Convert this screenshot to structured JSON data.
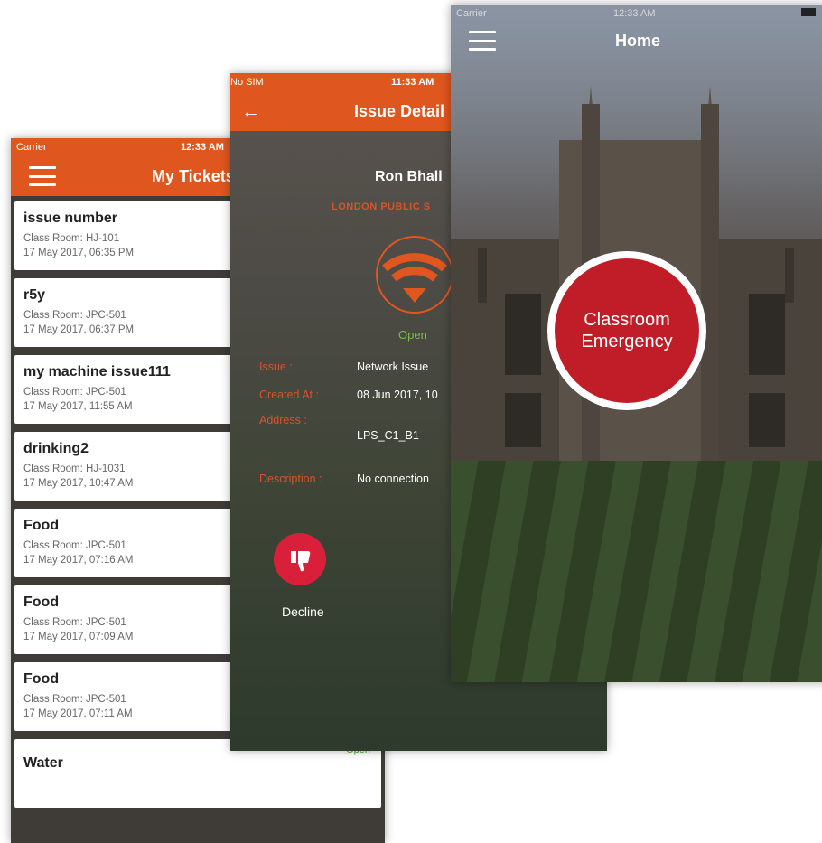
{
  "tickets_screen": {
    "status_bar": {
      "carrier": "Carrier",
      "time": "12:33 AM"
    },
    "title": "My Tickets",
    "tickets": [
      {
        "title": "issue number",
        "classroom": "Class Room:  HJ-101",
        "date": "17 May 2017, 06:35 PM",
        "status": ""
      },
      {
        "title": "r5y",
        "classroom": "Class Room:  JPC-501",
        "date": "17 May 2017, 06:37 PM",
        "status": ""
      },
      {
        "title": "my machine issue111",
        "classroom": "Class Room:  JPC-501",
        "date": "17 May 2017, 11:55 AM",
        "status": ""
      },
      {
        "title": "drinking2",
        "classroom": "Class Room:  HJ-1031",
        "date": "17 May 2017, 10:47 AM",
        "status": ""
      },
      {
        "title": "Food",
        "classroom": "Class Room:  JPC-501",
        "date": "17 May 2017, 07:16 AM",
        "status": ""
      },
      {
        "title": "Food",
        "classroom": "Class Room:  JPC-501",
        "date": "17 May 2017, 07:09 AM",
        "status": ""
      },
      {
        "title": "Food",
        "classroom": "Class Room:  JPC-501",
        "date": "17 May 2017, 07:11 AM",
        "status": ""
      },
      {
        "title": "Water",
        "classroom": "",
        "date": "",
        "status": "Open"
      }
    ]
  },
  "issue_screen": {
    "status_bar": {
      "carrier": "No SIM",
      "time": "11:33 AM"
    },
    "title": "Issue Detail",
    "name": "Ron Bhall",
    "school": "LONDON PUBLIC S",
    "status": "Open",
    "fields": {
      "issue_label": "Issue :",
      "issue_value": "Network Issue",
      "created_label": "Created At :",
      "created_value": "08 Jun 2017, 10",
      "address_label": "Address :",
      "address_value": "LPS_C1_B1",
      "description_label": "Description :",
      "description_value": "No connection"
    },
    "decline_label": "Decline"
  },
  "home_screen": {
    "status_bar": {
      "carrier": "Carrier",
      "time": "12:33 AM"
    },
    "title": "Home",
    "emergency_label_line1": "Classroom",
    "emergency_label_line2": "Emergency"
  },
  "colors": {
    "brand_orange": "#e0561f",
    "emergency_red": "#c11d28",
    "open_green": "#4cae2a",
    "decline_red": "#d8203b"
  }
}
